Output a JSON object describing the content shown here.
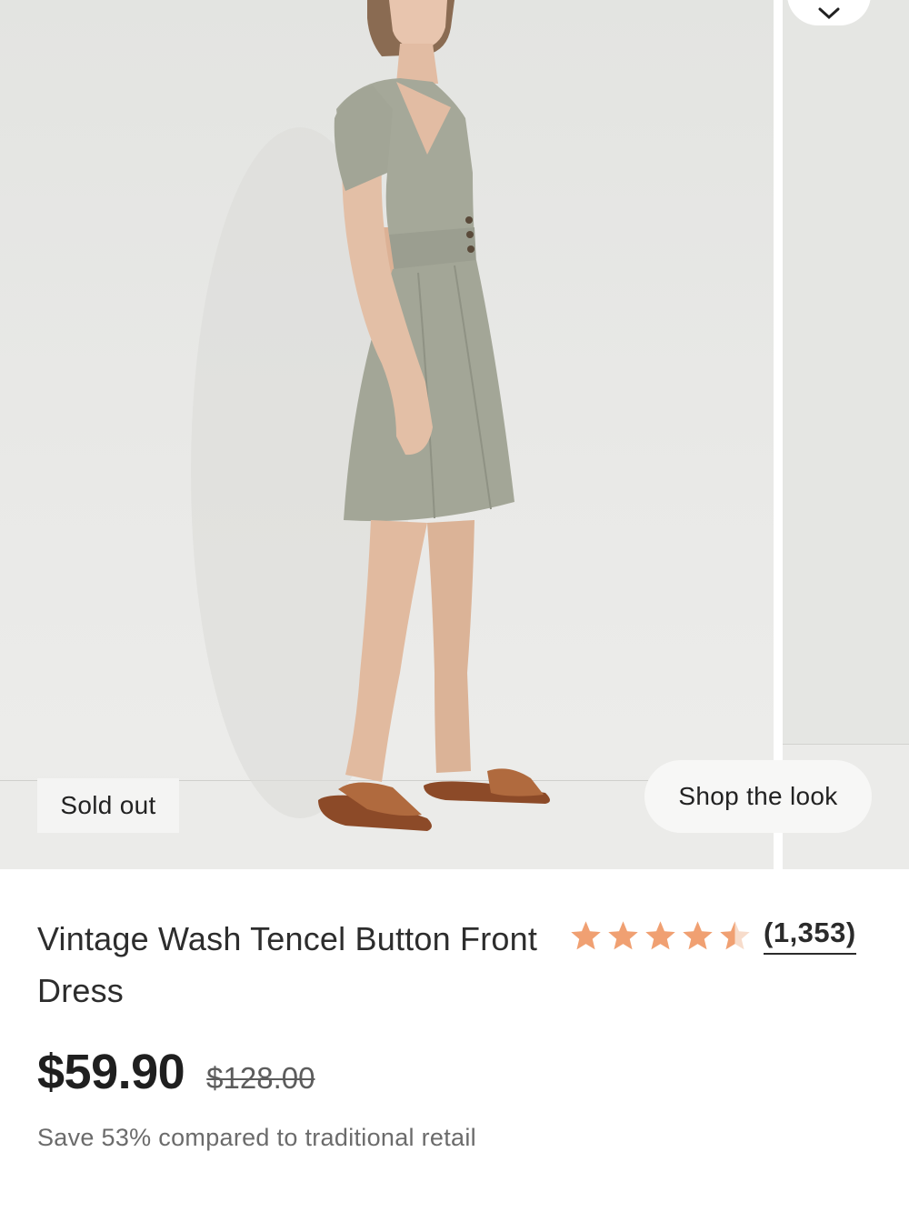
{
  "gallery": {
    "badge_label": "Sold out",
    "shop_look_label": "Shop the look",
    "favorite_icon": "chevron-down-icon"
  },
  "product": {
    "title": "Vintage Wash Tencel Button Front Dress",
    "rating": {
      "value_out_of_5": 4.5,
      "review_count": "(1,353)",
      "star_color": "#f0a072",
      "star_empty_color": "#f7dccb"
    },
    "price": "$59.90",
    "compare_price": "$128.00",
    "savings_text": "Save 53% compared to traditional retail"
  }
}
